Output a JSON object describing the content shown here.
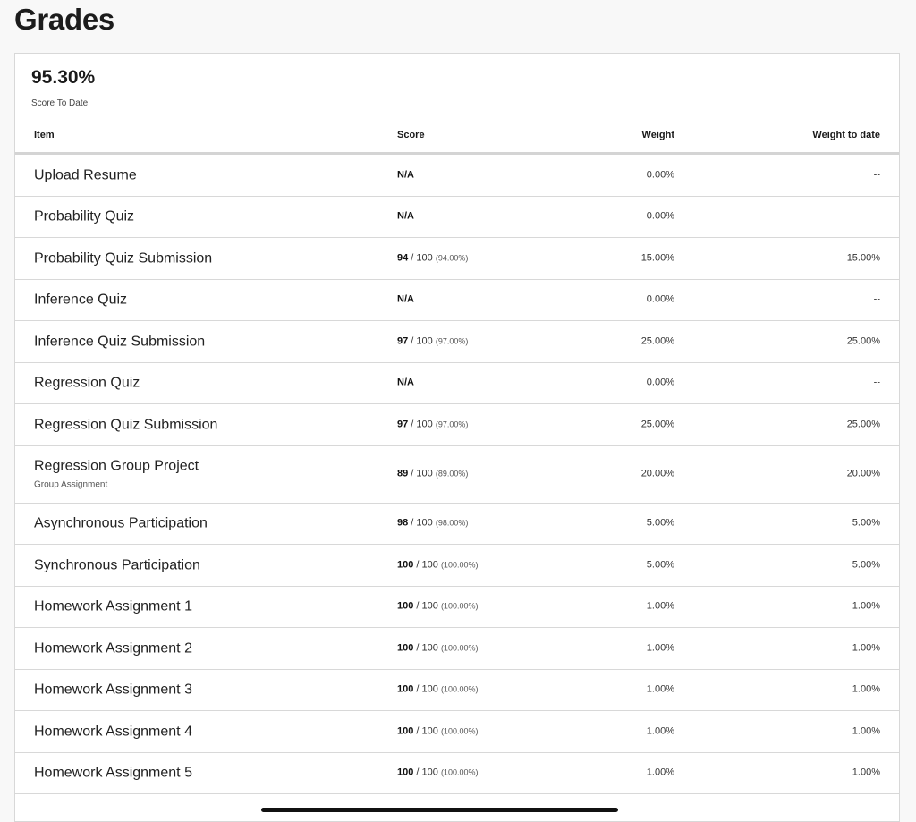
{
  "page": {
    "title": "Grades"
  },
  "summary": {
    "score": "95.30%",
    "caption": "Score To Date"
  },
  "table": {
    "headers": {
      "item": "Item",
      "score": "Score",
      "weight": "Weight",
      "weight_to_date": "Weight to date"
    },
    "rows": [
      {
        "name": "Upload Resume",
        "sub": "",
        "points": "N/A",
        "out_of": "",
        "percent": "",
        "weight": "0.00%",
        "weight_to_date": "--"
      },
      {
        "name": "Probability Quiz",
        "sub": "",
        "points": "N/A",
        "out_of": "",
        "percent": "",
        "weight": "0.00%",
        "weight_to_date": "--"
      },
      {
        "name": "Probability Quiz Submission",
        "sub": "",
        "points": "94",
        "out_of": " / 100 ",
        "percent": "(94.00%)",
        "weight": "15.00%",
        "weight_to_date": "15.00%"
      },
      {
        "name": "Inference Quiz",
        "sub": "",
        "points": "N/A",
        "out_of": "",
        "percent": "",
        "weight": "0.00%",
        "weight_to_date": "--"
      },
      {
        "name": "Inference Quiz Submission",
        "sub": "",
        "points": "97",
        "out_of": " / 100 ",
        "percent": "(97.00%)",
        "weight": "25.00%",
        "weight_to_date": "25.00%"
      },
      {
        "name": "Regression Quiz",
        "sub": "",
        "points": "N/A",
        "out_of": "",
        "percent": "",
        "weight": "0.00%",
        "weight_to_date": "--"
      },
      {
        "name": "Regression Quiz Submission",
        "sub": "",
        "points": "97",
        "out_of": " / 100 ",
        "percent": "(97.00%)",
        "weight": "25.00%",
        "weight_to_date": "25.00%"
      },
      {
        "name": "Regression Group Project",
        "sub": "Group Assignment",
        "points": "89",
        "out_of": " / 100 ",
        "percent": "(89.00%)",
        "weight": "20.00%",
        "weight_to_date": "20.00%"
      },
      {
        "name": "Asynchronous Participation",
        "sub": "",
        "points": "98",
        "out_of": " / 100 ",
        "percent": "(98.00%)",
        "weight": "5.00%",
        "weight_to_date": "5.00%"
      },
      {
        "name": "Synchronous Participation",
        "sub": "",
        "points": "100",
        "out_of": " / 100 ",
        "percent": "(100.00%)",
        "weight": "5.00%",
        "weight_to_date": "5.00%"
      },
      {
        "name": "Homework Assignment 1",
        "sub": "",
        "points": "100",
        "out_of": " / 100 ",
        "percent": "(100.00%)",
        "weight": "1.00%",
        "weight_to_date": "1.00%"
      },
      {
        "name": "Homework Assignment 2",
        "sub": "",
        "points": "100",
        "out_of": " / 100 ",
        "percent": "(100.00%)",
        "weight": "1.00%",
        "weight_to_date": "1.00%"
      },
      {
        "name": "Homework Assignment 3",
        "sub": "",
        "points": "100",
        "out_of": " / 100 ",
        "percent": "(100.00%)",
        "weight": "1.00%",
        "weight_to_date": "1.00%"
      },
      {
        "name": "Homework Assignment 4",
        "sub": "",
        "points": "100",
        "out_of": " / 100 ",
        "percent": "(100.00%)",
        "weight": "1.00%",
        "weight_to_date": "1.00%"
      },
      {
        "name": "Homework Assignment 5",
        "sub": "",
        "points": "100",
        "out_of": " / 100 ",
        "percent": "(100.00%)",
        "weight": "1.00%",
        "weight_to_date": "1.00%"
      }
    ]
  }
}
